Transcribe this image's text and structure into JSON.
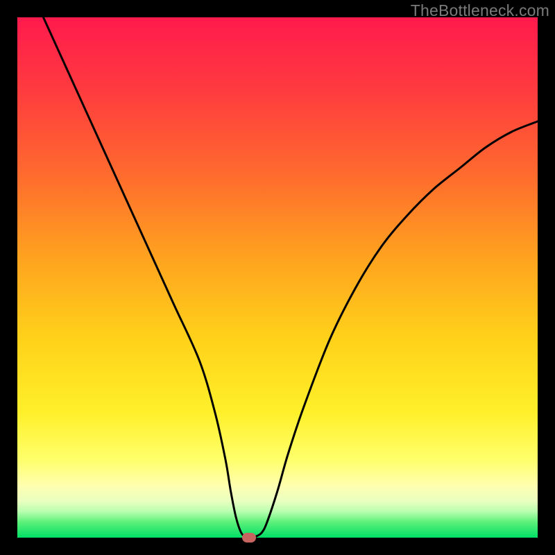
{
  "watermark": "TheBottleneck.com",
  "chart_data": {
    "type": "line",
    "title": "",
    "xlabel": "",
    "ylabel": "",
    "xlim": [
      0,
      100
    ],
    "ylim": [
      0,
      100
    ],
    "grid": false,
    "series": [
      {
        "name": "bottleneck-curve",
        "x": [
          5,
          10,
          15,
          20,
          25,
          30,
          35,
          38,
          40,
          41,
          42,
          43,
          44,
          45,
          46,
          47,
          48,
          50,
          52,
          55,
          60,
          65,
          70,
          75,
          80,
          85,
          90,
          95,
          100
        ],
        "values": [
          100,
          89,
          78,
          67,
          56,
          45,
          34,
          24,
          15,
          9,
          4,
          1,
          0,
          0,
          0.3,
          1,
          3,
          9,
          16,
          25,
          38,
          48,
          56,
          62,
          67,
          71,
          75,
          78,
          80
        ]
      }
    ],
    "marker": {
      "x": 44.5,
      "y": 0
    },
    "background": "rainbow-vertical-gradient",
    "colors": {
      "curve": "#000000",
      "marker": "#c86460",
      "frame": "#000000"
    }
  }
}
